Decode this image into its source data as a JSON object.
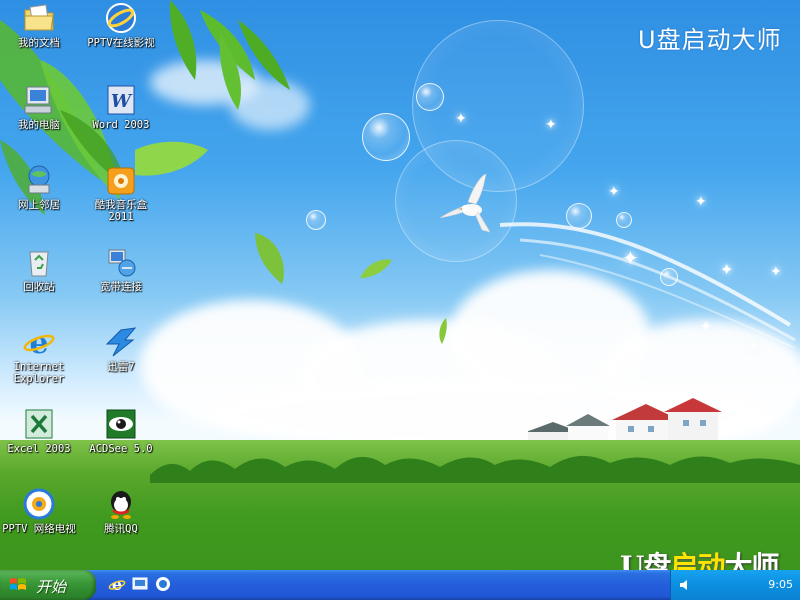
{
  "watermark": "U盘启动大师",
  "logo_stamp": {
    "part1": "U盘",
    "part2": "启动",
    "part3": "大师"
  },
  "desktop_icons": [
    {
      "label": "我的文档",
      "icon": "my-documents-icon"
    },
    {
      "label": "PPTV在线影视",
      "icon": "pptv-icon"
    },
    {
      "label": "我的电脑",
      "icon": "my-computer-icon"
    },
    {
      "label": "Word 2003",
      "icon": "word-icon"
    },
    {
      "label": "网上邻居",
      "icon": "network-places-icon"
    },
    {
      "label": "酷我音乐盒 2011",
      "icon": "kuwo-music-icon"
    },
    {
      "label": "回收站",
      "icon": "recycle-bin-icon"
    },
    {
      "label": "宽带连接",
      "icon": "broadband-connection-icon"
    },
    {
      "label": "Internet Explorer",
      "icon": "internet-explorer-icon"
    },
    {
      "label": "迅雷7",
      "icon": "xunlei-icon"
    },
    {
      "label": "Excel 2003",
      "icon": "excel-icon"
    },
    {
      "label": "ACDSee 5.0",
      "icon": "acdsee-icon"
    },
    {
      "label": "PPTV 网络电视",
      "icon": "pptv-tv-icon"
    },
    {
      "label": "腾讯QQ",
      "icon": "qq-icon"
    }
  ],
  "taskbar": {
    "start_label": "开始",
    "quick_launch": [
      "internet-explorer-icon",
      "show-desktop-icon",
      "media-icon"
    ],
    "clock": "9:05"
  },
  "colors": {
    "taskbar": "#245edb",
    "start": "#3c9a3a",
    "tray": "#0c8fe0"
  }
}
